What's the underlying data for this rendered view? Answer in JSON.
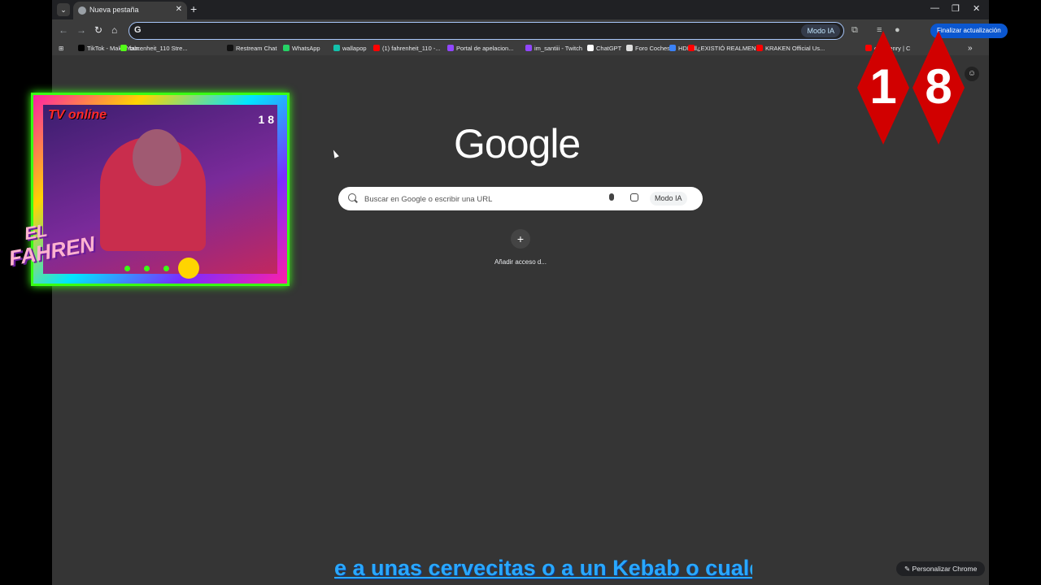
{
  "browser": {
    "tab": {
      "title": "Nueva pestaña"
    },
    "omnibox": {
      "value": "",
      "modo_ia_label": "Modo IA"
    },
    "update_button": "Finalizar actualización",
    "bookmarks": [
      {
        "label": "TikTok - Make Your...",
        "color": "#000000"
      },
      {
        "label": "fahrenheit_110 Stre...",
        "color": "#53fc18"
      },
      {
        "label": "Restream Chat",
        "color": "#111111"
      },
      {
        "label": "WhatsApp",
        "color": "#25d366"
      },
      {
        "label": "wallapop",
        "color": "#13c1ac"
      },
      {
        "label": "(1) fahrenheit_110 -...",
        "color": "#ff0000"
      },
      {
        "label": "Portal de apelacion...",
        "color": "#9146ff"
      },
      {
        "label": "im_santiii - Twitch",
        "color": "#9146ff"
      },
      {
        "label": "ChatGPT",
        "color": "#ffffff"
      },
      {
        "label": "Foro Coches",
        "color": "#dddddd"
      },
      {
        "label": "HDFull",
        "color": "#3b82f6"
      },
      {
        "label": "¿EXISTIÓ REALMEN...",
        "color": "#ff0000"
      },
      {
        "label": "KRAKEN Official Us...",
        "color": "#ff0000"
      },
      {
        "label": "ore Henry | C",
        "color": "#ff0000"
      }
    ],
    "bookmarks_more": "»"
  },
  "ntp": {
    "logo": "Google",
    "search_placeholder": "Buscar en Google o escribir una URL",
    "search_modo_ia": "Modo IA",
    "shortcut_plus": "+",
    "shortcut_label": "Añadir acceso d...",
    "customize": "Personalizar Chrome"
  },
  "overlay": {
    "cam_title": "TV online",
    "cam_age": "1 8",
    "fahren_el": "EL",
    "fahren_name": "FAHREN",
    "age_digit_1": "1",
    "age_digit_2": "8",
    "ticker": "e a unas cervecitas o a un Kebab o cualq"
  },
  "colors": {
    "accent": "#a8c7fa",
    "update_button": "#0b57d0",
    "ticker": "#29a8ff",
    "age_badge": "#d10000"
  }
}
